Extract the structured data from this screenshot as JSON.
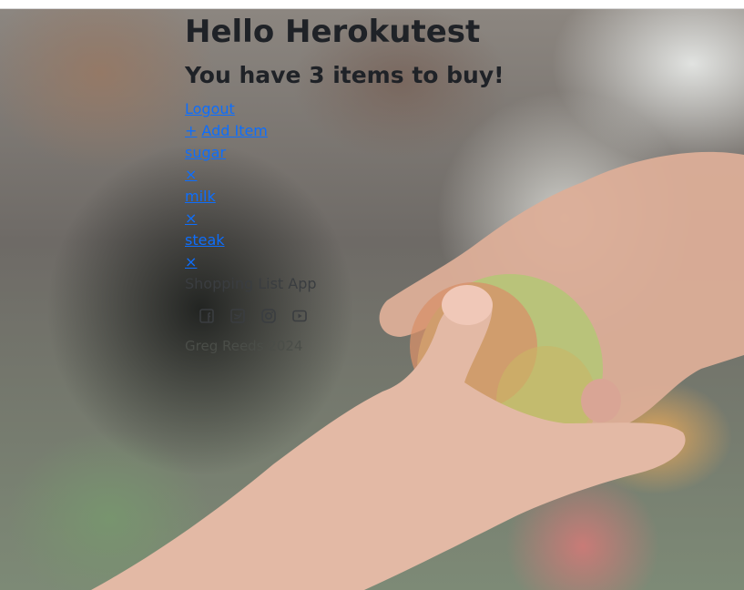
{
  "header": {
    "greeting": "Hello Herokutest",
    "summary": "You have 3 items to buy!"
  },
  "nav": {
    "logout_label": "Logout",
    "add_item_icon": "+",
    "add_item_label": "Add Item"
  },
  "items": [
    {
      "name": "sugar",
      "remove_label": "×"
    },
    {
      "name": "milk",
      "remove_label": "×"
    },
    {
      "name": "steak",
      "remove_label": "×"
    }
  ],
  "footer": {
    "app_name": "Shopping List App",
    "social_icons": [
      "facebook-icon",
      "twitter-icon",
      "instagram-icon",
      "youtube-icon"
    ],
    "copyright": "Greg Reeds 2024"
  },
  "colors": {
    "link": "#0d6efd",
    "heading": "#1f2227"
  }
}
